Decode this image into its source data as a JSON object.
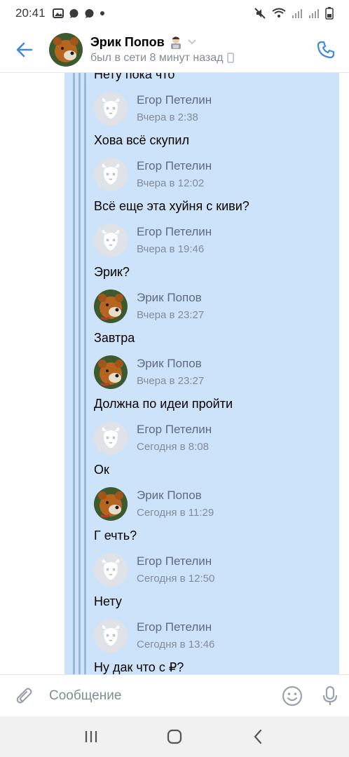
{
  "status_bar": {
    "time": "20:41"
  },
  "header": {
    "name": "Эрик Попов",
    "status": "был в сети 8 минут назад"
  },
  "messages": [
    {
      "kind": "text",
      "text": "Нету пока что"
    },
    {
      "kind": "author",
      "name": "Егор Петелин",
      "time": "Вчера в 2:38",
      "avatar": "dog"
    },
    {
      "kind": "text",
      "text": "Хова всё скупил"
    },
    {
      "kind": "author",
      "name": "Егор Петелин",
      "time": "Вчера в 12:02",
      "avatar": "dog"
    },
    {
      "kind": "text",
      "text": "Всё еще эта хуйня с киви?"
    },
    {
      "kind": "author",
      "name": "Егор Петелин",
      "time": "Вчера в 19:46",
      "avatar": "dog"
    },
    {
      "kind": "text",
      "text": "Эрик?"
    },
    {
      "kind": "author",
      "name": "Эрик Попов",
      "time": "Вчера в 23:27",
      "avatar": "bear"
    },
    {
      "kind": "text",
      "text": "Завтра"
    },
    {
      "kind": "author",
      "name": "Эрик Попов",
      "time": "Вчера в 23:27",
      "avatar": "bear"
    },
    {
      "kind": "text",
      "text": "Должна по идеи пройти"
    },
    {
      "kind": "author",
      "name": "Егор Петелин",
      "time": "Сегодня в 8:08",
      "avatar": "dog"
    },
    {
      "kind": "text",
      "text": "Ок"
    },
    {
      "kind": "author",
      "name": "Эрик Попов",
      "time": "Сегодня в 11:29",
      "avatar": "bear"
    },
    {
      "kind": "text",
      "text": "Г ечть?"
    },
    {
      "kind": "author",
      "name": "Егор Петелин",
      "time": "Сегодня в 12:50",
      "avatar": "dog"
    },
    {
      "kind": "text",
      "text": "Нету"
    },
    {
      "kind": "author",
      "name": "Егор Петелин",
      "time": "Сегодня в 13:46",
      "avatar": "dog"
    },
    {
      "kind": "text",
      "text": "Ну дак что с ₽?"
    }
  ],
  "composer": {
    "placeholder": "Сообщение"
  },
  "colors": {
    "accent": "#3f8ae0",
    "forward_bg": "#cde3fa",
    "forward_line": "#9ab8de"
  }
}
